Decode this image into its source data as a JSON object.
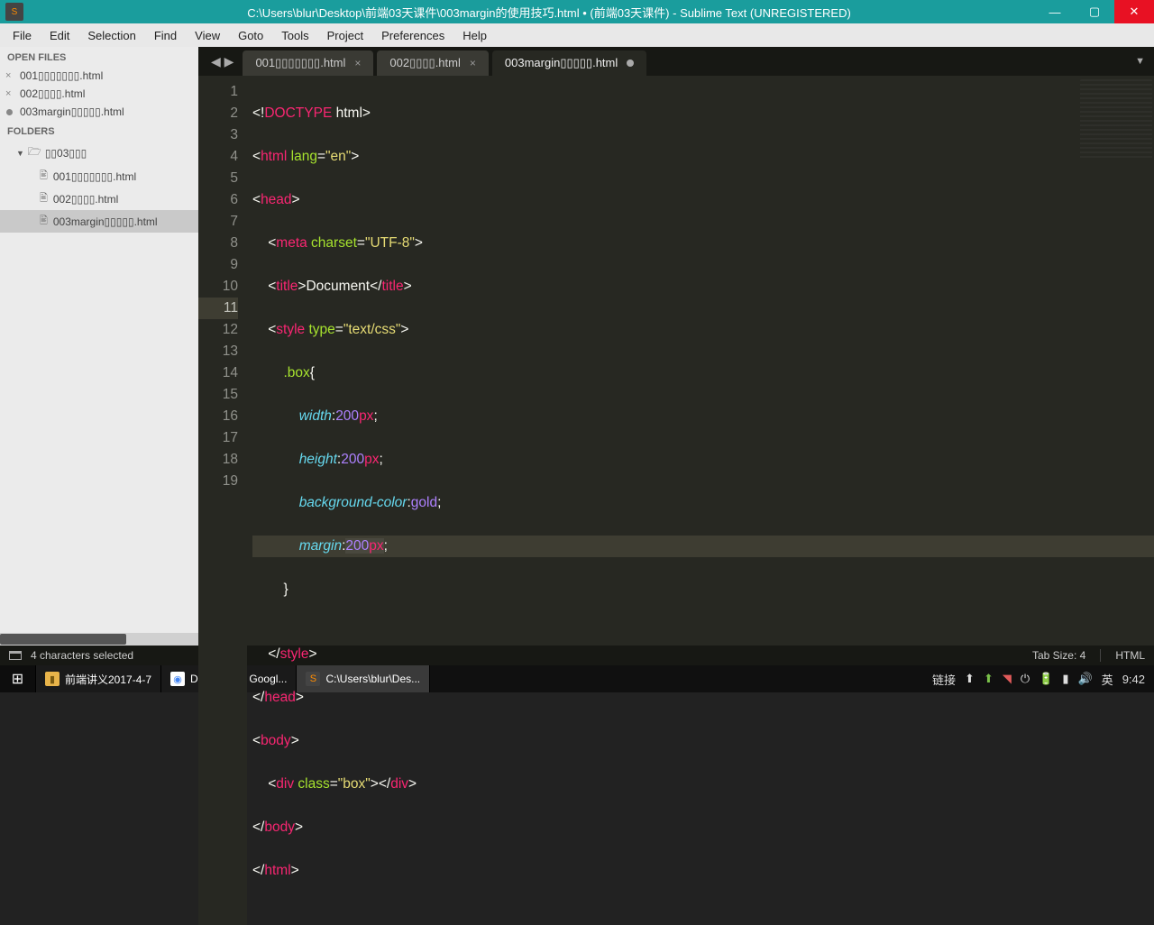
{
  "window": {
    "title": "C:\\Users\\blur\\Desktop\\前端03天课件\\003margin的使用技巧.html • (前端03天课件) - Sublime Text (UNREGISTERED)"
  },
  "menu": {
    "file": "File",
    "edit": "Edit",
    "selection": "Selection",
    "find": "Find",
    "view": "View",
    "goto": "Goto",
    "tools": "Tools",
    "project": "Project",
    "preferences": "Preferences",
    "help": "Help"
  },
  "sidebar": {
    "open_files_header": "OPEN FILES",
    "open_files": [
      {
        "name": "001▯▯▯▯▯▯▯.html",
        "dirty": false
      },
      {
        "name": "002▯▯▯▯.html",
        "dirty": false
      },
      {
        "name": "003margin▯▯▯▯▯.html",
        "dirty": true
      }
    ],
    "folders_header": "FOLDERS",
    "folder_name": "▯▯03▯▯▯",
    "folder_files": [
      "001▯▯▯▯▯▯▯.html",
      "002▯▯▯▯.html",
      "003margin▯▯▯▯▯.html"
    ],
    "folder_selected_index": 2
  },
  "tabs": [
    {
      "label": "001▯▯▯▯▯▯▯.html",
      "dirty": false,
      "active": false
    },
    {
      "label": "002▯▯▯▯.html",
      "dirty": false,
      "active": false
    },
    {
      "label": "003margin▯▯▯▯▯.html",
      "dirty": true,
      "active": true
    }
  ],
  "code": {
    "line_count": 19,
    "current_line": 11,
    "l1": {
      "a": "<!",
      "b": "DOCTYPE",
      "c": " html",
      "d": ">"
    },
    "l2": {
      "a": "<",
      "b": "html",
      "c": " lang",
      "d": "=",
      "e": "\"en\"",
      "f": ">"
    },
    "l3": {
      "a": "<",
      "b": "head",
      "c": ">"
    },
    "l4": {
      "a": "    <",
      "b": "meta",
      "c": " charset",
      "d": "=",
      "e": "\"UTF-8\"",
      "f": ">"
    },
    "l5": {
      "a": "    <",
      "b": "title",
      "c": ">",
      "d": "Document",
      "e": "</",
      "f": "title",
      "g": ">"
    },
    "l6": {
      "a": "    <",
      "b": "style",
      "c": " type",
      "d": "=",
      "e": "\"text/css\"",
      "f": ">"
    },
    "l7": {
      "a": "        ",
      "b": ".box",
      "c": "{"
    },
    "l8": {
      "a": "            ",
      "b": "width",
      "c": ":",
      "d": "200",
      "e": "px",
      "f": ";"
    },
    "l9": {
      "a": "            ",
      "b": "height",
      "c": ":",
      "d": "200",
      "e": "px",
      "f": ";"
    },
    "l10": {
      "a": "            ",
      "b": "background-color",
      "c": ":",
      "d": "gold",
      "e": ";"
    },
    "l11": {
      "a": "            ",
      "b": "margin",
      "c": ":",
      "d": "200",
      "e": "px",
      "f": ";"
    },
    "l12": {
      "a": "        }"
    },
    "l13": {
      "a": ""
    },
    "l14": {
      "a": "    </",
      "b": "style",
      "c": ">"
    },
    "l15": {
      "a": "</",
      "b": "head",
      "c": ">"
    },
    "l16": {
      "a": "<",
      "b": "body",
      "c": ">"
    },
    "l17": {
      "a": "    <",
      "b": "div",
      "c": " class",
      "d": "=",
      "e": "\"box\"",
      "f": "></",
      "g": "div",
      "h": ">"
    },
    "l18": {
      "a": "</",
      "b": "body",
      "c": ">"
    },
    "l19": {
      "a": "</",
      "b": "html",
      "c": ">"
    }
  },
  "statusbar": {
    "selection": "4 characters selected",
    "tab_size": "Tab Size: 4",
    "syntax": "HTML"
  },
  "taskbar": {
    "items": [
      {
        "label": "前端讲义2017-4-7",
        "icon": "folder"
      },
      {
        "label": "Document - Googl...",
        "icon": "chrome"
      },
      {
        "label": "C:\\Users\\blur\\Des...",
        "icon": "subl"
      }
    ],
    "tray": {
      "link": "链接",
      "ime": "英",
      "time": "9:42"
    }
  }
}
